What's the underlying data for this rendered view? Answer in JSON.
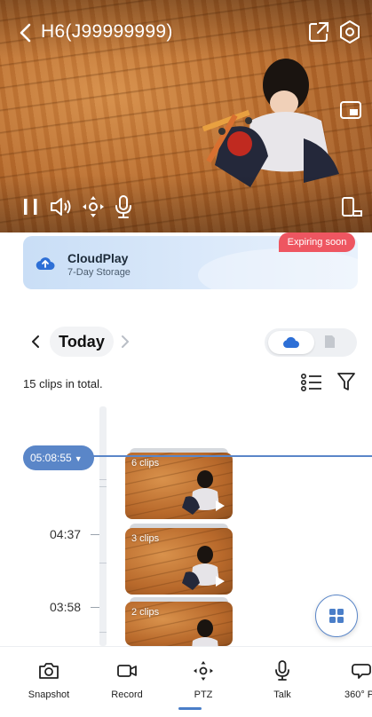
{
  "header": {
    "camera_title": "H6(J99999999)",
    "icons": [
      "back-arrow",
      "share",
      "settings",
      "picture-in-picture",
      "pause",
      "volume",
      "ptz",
      "microphone",
      "screen-rotate"
    ]
  },
  "cloud_banner": {
    "title": "CloudPlay",
    "subtitle": "7-Day Storage",
    "badge": "Expiring soon",
    "badge_color": "#ee5661"
  },
  "date_nav": {
    "label": "Today"
  },
  "clips": {
    "count_text": "15 clips in total.",
    "cursor_time": "05:08:55",
    "time_labels": [
      "04:37",
      "03:58"
    ],
    "groups": [
      {
        "label": "6 clips"
      },
      {
        "label": "3 clips"
      },
      {
        "label": "2 clips"
      }
    ]
  },
  "toolbar": {
    "items": [
      {
        "label": "Snapshot",
        "icon": "camera"
      },
      {
        "label": "Record",
        "icon": "video-camera"
      },
      {
        "label": "PTZ",
        "icon": "ptz",
        "active": true
      },
      {
        "label": "Talk",
        "icon": "microphone"
      },
      {
        "label": "360° P",
        "icon": "360-view"
      }
    ]
  },
  "colors": {
    "accent": "#5a86c8",
    "badge": "#ee5661",
    "banner": "#dbe9fa"
  }
}
